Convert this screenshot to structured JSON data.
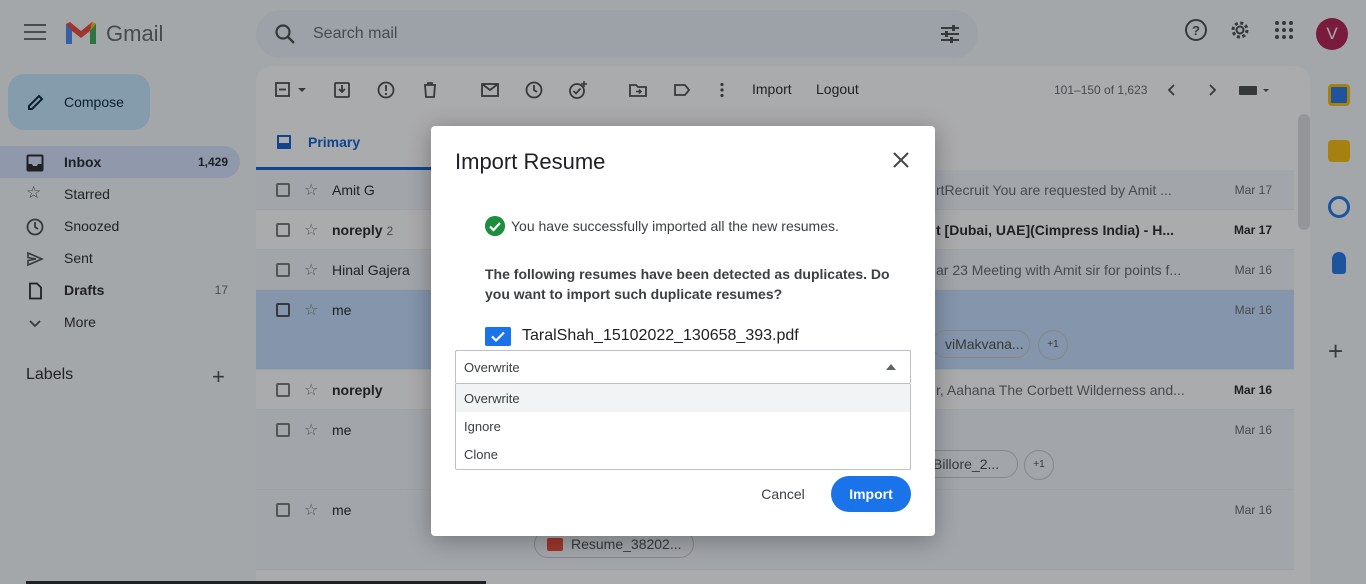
{
  "app": {
    "brand": "Gmail",
    "avatar_letter": "V"
  },
  "search": {
    "placeholder": "Search mail"
  },
  "compose": {
    "label": "Compose"
  },
  "sidebar": {
    "items": [
      {
        "label": "Inbox",
        "count": "1,429"
      },
      {
        "label": "Starred",
        "count": ""
      },
      {
        "label": "Snoozed",
        "count": ""
      },
      {
        "label": "Sent",
        "count": ""
      },
      {
        "label": "Drafts",
        "count": "17"
      },
      {
        "label": "More",
        "count": ""
      }
    ],
    "labels_heading": "Labels"
  },
  "toolbar": {
    "import_label": "Import",
    "logout_label": "Logout",
    "pager": "101–150 of 1,623"
  },
  "tabs": {
    "primary": "Primary"
  },
  "emails": [
    {
      "sender": "Amit G",
      "thread_count": "",
      "subject": "rtRecruit You are requested by Amit ...",
      "date": "Mar 17"
    },
    {
      "sender": "noreply",
      "thread_count": "2",
      "subject": "t [Dubai, UAE](Cimpress India) - H...",
      "date": "Mar 17"
    },
    {
      "sender": "Hinal Gajera",
      "thread_count": "",
      "subject": "ar 23 Meeting with Amit sir for points f...",
      "date": "Mar 16"
    },
    {
      "sender": "me",
      "thread_count": "",
      "subject": "",
      "date": "Mar 16",
      "chip": "viMakvana...",
      "more": "+1"
    },
    {
      "sender": "noreply",
      "thread_count": "",
      "subject": "r, Aahana The Corbett Wilderness and...",
      "date": "Mar 16"
    },
    {
      "sender": "me",
      "thread_count": "",
      "subject": "",
      "date": "Mar 16",
      "chip": "Billore_2...",
      "more": "+1"
    },
    {
      "sender": "me",
      "thread_count": "",
      "subject": "",
      "date": "Mar 16",
      "chip": "Resume_38202..."
    }
  ],
  "dialog": {
    "title": "Import Resume",
    "success_message": "You have successfully imported all the new resumes.",
    "duplicate_question": "The following resumes have been detected as duplicates. Do you want to import such duplicate resumes?",
    "file_name": "TaralShah_15102022_130658_393.pdf",
    "selected_option": "Overwrite",
    "options": [
      "Overwrite",
      "Ignore",
      "Clone"
    ],
    "cancel_label": "Cancel",
    "import_label": "Import"
  },
  "colors": {
    "primary_blue": "#1a73e8",
    "success_green": "#1e8e3e",
    "selected_row": "#c2dbff"
  }
}
